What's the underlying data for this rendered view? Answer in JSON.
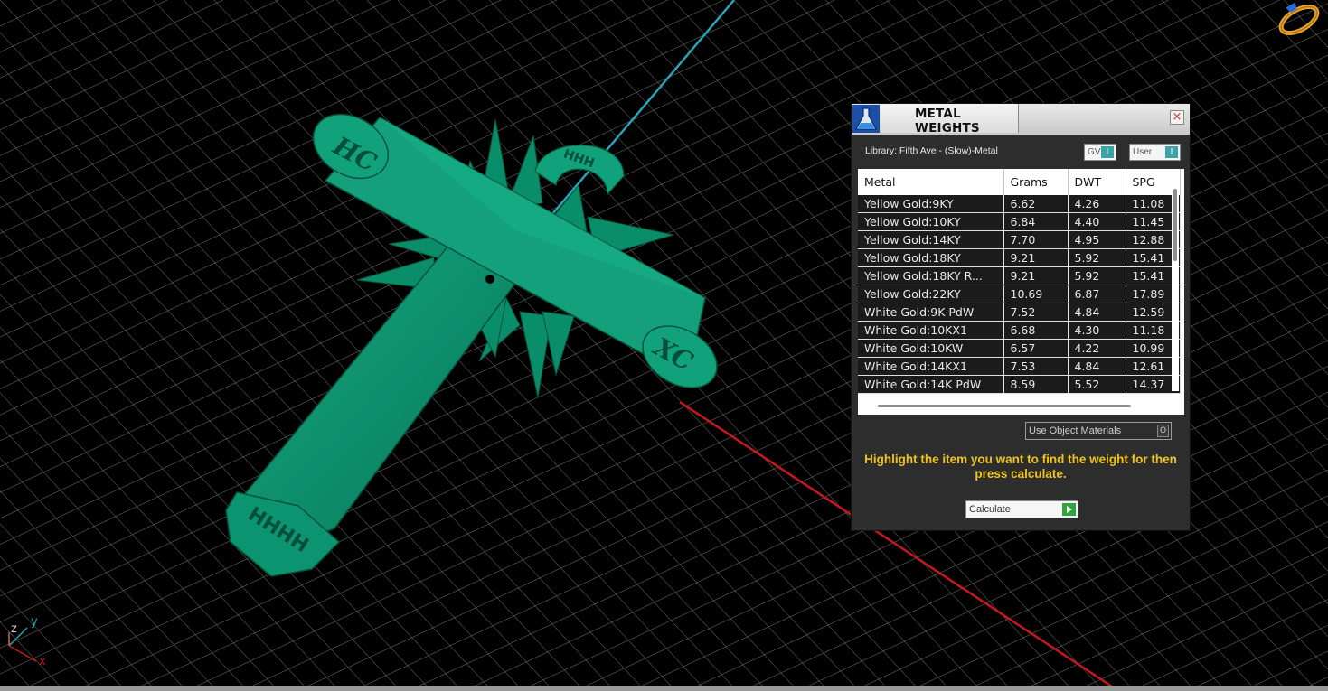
{
  "colors": {
    "model_green": "#0b8e6b",
    "grid_line": "#7c7c7c",
    "x_axis": "#c8161d",
    "y_axis": "#2aa3b8",
    "accent_teal": "#3ca3a8",
    "instruction_yellow": "#f0c419"
  },
  "viewport": {
    "cross_hub_text": "HHH",
    "bottom_text": "HHHH",
    "left_arm_text": "HC",
    "right_arm_text": "XC",
    "gizmo": {
      "z": "z",
      "y": "y",
      "x": "x"
    },
    "corner_icon": "ring-navigation-icon"
  },
  "panel": {
    "title": "METAL WEIGHTS",
    "close_icon": "×",
    "library_label": "Library: Fifth Ave - (Slow)-Metal",
    "gv_label": "GV",
    "user_label": "User",
    "dropdown_btn": "I",
    "columns": [
      "Metal",
      "Grams",
      "DWT",
      "SPG"
    ],
    "rows": [
      [
        "Yellow Gold:9KY",
        "6.62",
        "4.26",
        "11.08"
      ],
      [
        "Yellow Gold:10KY",
        "6.84",
        "4.40",
        "11.45"
      ],
      [
        "Yellow Gold:14KY",
        "7.70",
        "4.95",
        "12.88"
      ],
      [
        "Yellow Gold:18KY",
        "9.21",
        "5.92",
        "15.41"
      ],
      [
        "Yellow Gold:18KY R...",
        "9.21",
        "5.92",
        "15.41"
      ],
      [
        "Yellow Gold:22KY",
        "10.69",
        "6.87",
        "17.89"
      ],
      [
        "White Gold:9K PdW",
        "7.52",
        "4.84",
        "12.59"
      ],
      [
        "White Gold:10KX1",
        "6.68",
        "4.30",
        "11.18"
      ],
      [
        "White Gold:10KW",
        "6.57",
        "4.22",
        "10.99"
      ],
      [
        "White Gold:14KX1",
        "7.53",
        "4.84",
        "12.61"
      ],
      [
        "White Gold:14K PdW",
        "8.59",
        "5.52",
        "14.37"
      ]
    ],
    "use_object_materials": "Use Object Materials",
    "use_object_btn": "O",
    "instruction": "Highlight the item you want to find the weight for then press calculate.",
    "calculate_label": "Calculate"
  }
}
